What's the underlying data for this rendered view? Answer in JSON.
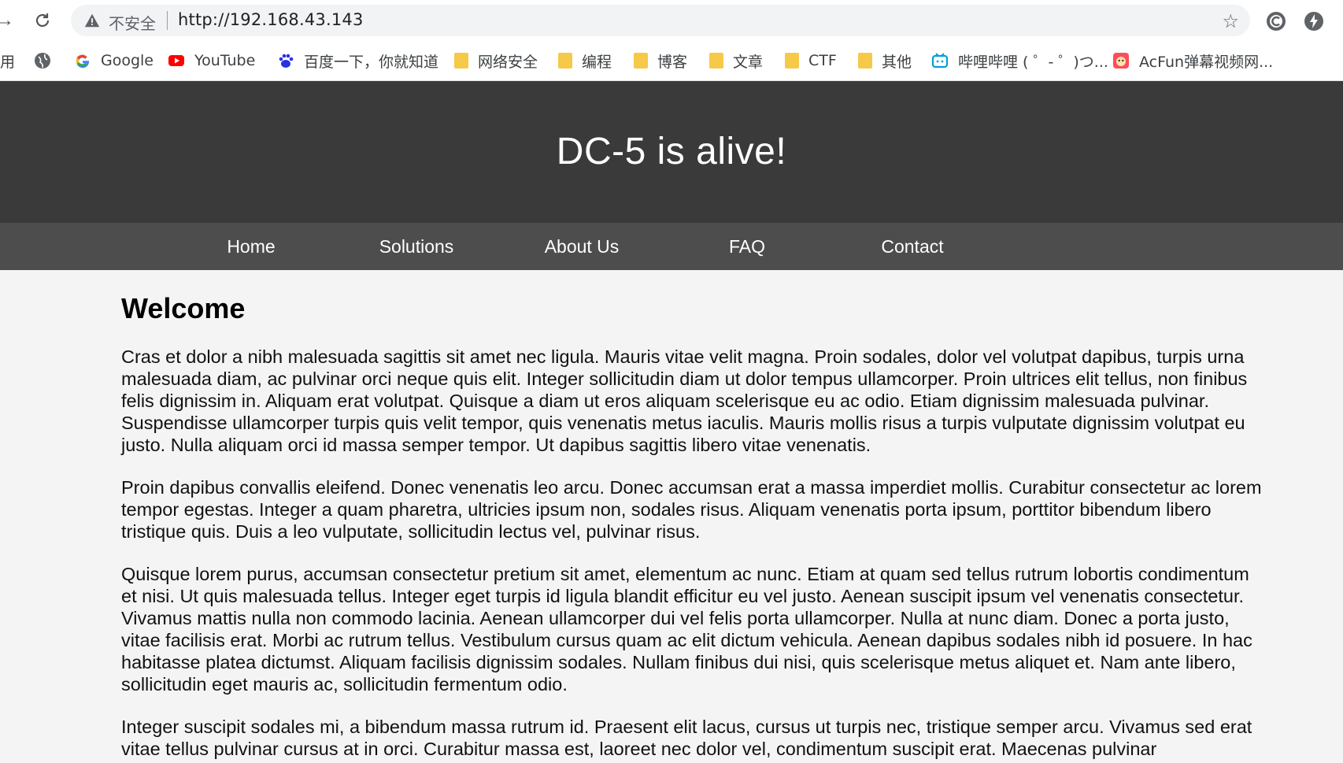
{
  "browser": {
    "security_label": "不安全",
    "url": "http://192.168.43.143",
    "bookmarks": [
      {
        "label": "用",
        "icon": "apps-icon"
      },
      {
        "label": "",
        "icon": "globe-icon"
      },
      {
        "label": "Google",
        "icon": "google-icon"
      },
      {
        "label": "YouTube",
        "icon": "youtube-icon"
      },
      {
        "label": "百度一下，你就知道",
        "icon": "baidu-icon"
      },
      {
        "label": "网络安全",
        "icon": "folder-icon"
      },
      {
        "label": "编程",
        "icon": "folder-icon"
      },
      {
        "label": "博客",
        "icon": "folder-icon"
      },
      {
        "label": "文章",
        "icon": "folder-icon"
      },
      {
        "label": "CTF",
        "icon": "folder-icon"
      },
      {
        "label": "其他",
        "icon": "folder-icon"
      },
      {
        "label": "哔哩哔哩 ( ゜- ゜)つ...",
        "icon": "bilibili-icon"
      },
      {
        "label": "AcFun弹幕视频网...",
        "icon": "acfun-icon"
      }
    ]
  },
  "page": {
    "title": "DC-5 is alive!",
    "nav": [
      "Home",
      "Solutions",
      "About Us",
      "FAQ",
      "Contact"
    ],
    "heading": "Welcome",
    "paragraphs": [
      "Cras et dolor a nibh malesuada sagittis sit amet nec ligula. Mauris vitae velit magna. Proin sodales, dolor vel volutpat dapibus, turpis urna malesuada diam, ac pulvinar orci neque quis elit. Integer sollicitudin diam ut dolor tempus ullamcorper. Proin ultrices elit tellus, non finibus felis dignissim in. Aliquam erat volutpat. Quisque a diam ut eros aliquam scelerisque eu ac odio. Etiam dignissim malesuada pulvinar. Suspendisse ullamcorper turpis quis velit tempor, quis venenatis metus iaculis. Mauris mollis risus a turpis vulputate dignissim volutpat eu justo. Nulla aliquam orci id massa semper tempor. Ut dapibus sagittis libero vitae venenatis.",
      "Proin dapibus convallis eleifend. Donec venenatis leo arcu. Donec accumsan erat a massa imperdiet mollis. Curabitur consectetur ac lorem tempor egestas. Integer a quam pharetra, ultricies ipsum non, sodales risus. Aliquam venenatis porta ipsum, porttitor bibendum libero tristique quis. Duis a leo vulputate, sollicitudin lectus vel, pulvinar risus.",
      "Quisque lorem purus, accumsan consectetur pretium sit amet, elementum ac nunc. Etiam at quam sed tellus rutrum lobortis condimentum et nisi. Ut quis malesuada tellus. Integer eget turpis id ligula blandit efficitur eu vel justo. Aenean suscipit ipsum vel venenatis consectetur. Vivamus mattis nulla non commodo lacinia. Aenean ullamcorper dui vel felis porta ullamcorper. Nulla at nunc diam. Donec a porta justo, vitae facilisis erat. Morbi ac rutrum tellus. Vestibulum cursus quam ac elit dictum vehicula. Aenean dapibus sodales nibh id posuere. In hac habitasse platea dictumst. Aliquam facilisis dignissim sodales. Nullam finibus dui nisi, quis scelerisque metus aliquet et. Nam ante libero, sollicitudin eget mauris ac, sollicitudin fermentum odio.",
      "Integer suscipit sodales mi, a bibendum massa rutrum id. Praesent elit lacus, cursus ut turpis nec, tristique semper arcu. Vivamus sed erat vitae tellus pulvinar cursus at in orci. Curabitur massa est, laoreet nec dolor vel, condimentum suscipit erat. Maecenas pulvinar"
    ]
  },
  "colors": {
    "header_bg": "#3a3a3a",
    "menu_bg": "#4d4d4d",
    "page_bg": "#f4f4f4"
  }
}
